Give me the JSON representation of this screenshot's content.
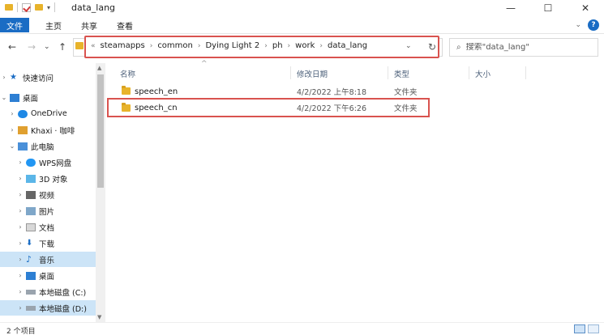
{
  "window": {
    "title": "data_lang",
    "controls": {
      "minimize": "—",
      "maximize": "☐",
      "close": "✕"
    }
  },
  "ribbon": {
    "tabs": [
      "文件",
      "主页",
      "共享",
      "查看"
    ],
    "help": "?"
  },
  "nav": {
    "back": "←",
    "forward": "→",
    "dropdown": "⌄",
    "up": "↑"
  },
  "address": {
    "prefix": "«",
    "crumbs": [
      "steamapps",
      "common",
      "Dying Light 2",
      "ph",
      "work",
      "data_lang"
    ],
    "separator": "›"
  },
  "search": {
    "placeholder": "搜索\"data_lang\""
  },
  "columns": {
    "name": "名称",
    "date": "修改日期",
    "type": "类型",
    "size": "大小"
  },
  "files": [
    {
      "name": "speech_en",
      "date": "4/2/2022 上午8:18",
      "type": "文件夹"
    },
    {
      "name": "speech_cn",
      "date": "4/2/2022 下午6:26",
      "type": "文件夹"
    }
  ],
  "sidebar": {
    "items": [
      {
        "label": "快速访问",
        "icon": "star-icon"
      },
      {
        "label": "桌面",
        "icon": "desktop-icon"
      },
      {
        "label": "OneDrive",
        "icon": "cloud-icon"
      },
      {
        "label": "Khaxi · 咖啡",
        "icon": "user-icon"
      },
      {
        "label": "此电脑",
        "icon": "computer-icon"
      },
      {
        "label": "WPS网盘",
        "icon": "cloud-icon"
      },
      {
        "label": "3D 对象",
        "icon": "cube-icon"
      },
      {
        "label": "视频",
        "icon": "video-icon"
      },
      {
        "label": "图片",
        "icon": "picture-icon"
      },
      {
        "label": "文档",
        "icon": "document-icon"
      },
      {
        "label": "下载",
        "icon": "download-icon"
      },
      {
        "label": "音乐",
        "icon": "music-icon"
      },
      {
        "label": "桌面",
        "icon": "desktop-icon"
      },
      {
        "label": "本地磁盘 (C:)",
        "icon": "drive-icon"
      },
      {
        "label": "本地磁盘 (D:)",
        "icon": "drive-icon"
      }
    ]
  },
  "status": {
    "count": "2 个项目"
  },
  "colors": {
    "accent": "#1a6cc4",
    "highlight_border": "#d9534f",
    "selected_bg": "#cce4f7",
    "folder": "#e8b32b"
  }
}
